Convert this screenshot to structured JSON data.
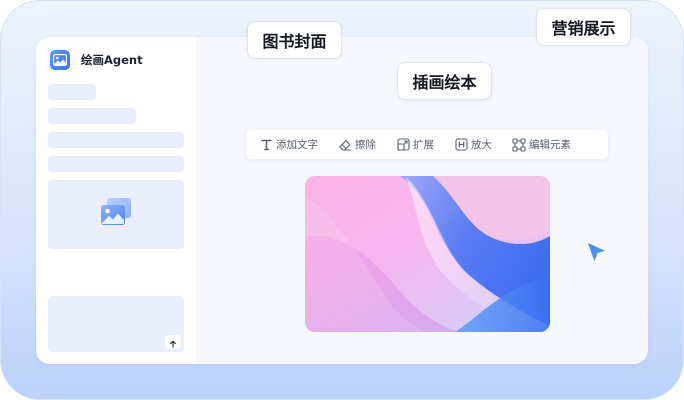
{
  "app": {
    "name": "绘画Agent",
    "brand_icon": "picture-icon"
  },
  "floating_tags": [
    "图书封面",
    "营销展示",
    "插画绘本"
  ],
  "toolbar": {
    "items": [
      {
        "label": "添加文字",
        "icon": "text-icon"
      },
      {
        "label": "擦除",
        "icon": "eraser-icon"
      },
      {
        "label": "扩展",
        "icon": "expand-icon"
      },
      {
        "label": "放大",
        "icon": "upscale-icon"
      },
      {
        "label": "编辑元素",
        "icon": "edit-element-icon"
      }
    ]
  },
  "sidebar": {
    "image_placeholder_icon": "gallery-icon",
    "send_button_icon": "arrow-up-icon"
  },
  "canvas": {
    "image": "abstract-gradient-wave"
  },
  "colors": {
    "accent": "#3b82f6",
    "background_gradient": [
      "#eef3fd",
      "#bcd2fb"
    ],
    "skeleton": "#e9effc"
  }
}
